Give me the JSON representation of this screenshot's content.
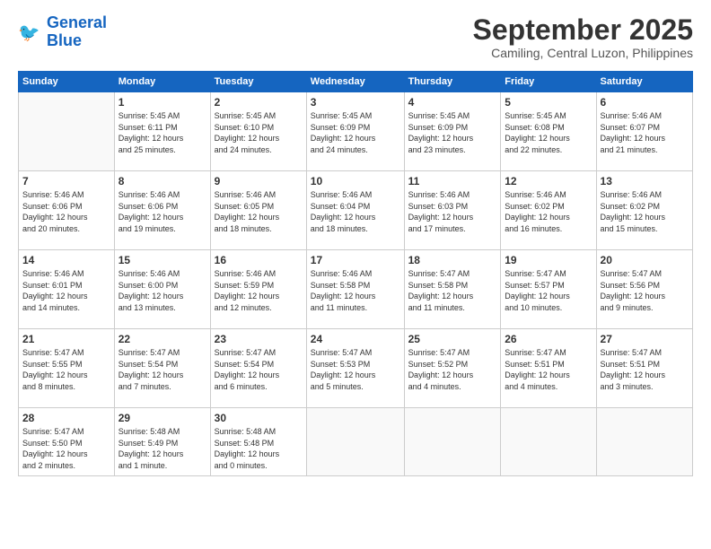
{
  "logo": {
    "line1": "General",
    "line2": "Blue"
  },
  "title": "September 2025",
  "location": "Camiling, Central Luzon, Philippines",
  "days_header": [
    "Sunday",
    "Monday",
    "Tuesday",
    "Wednesday",
    "Thursday",
    "Friday",
    "Saturday"
  ],
  "weeks": [
    [
      {
        "day": "",
        "info": ""
      },
      {
        "day": "1",
        "info": "Sunrise: 5:45 AM\nSunset: 6:11 PM\nDaylight: 12 hours\nand 25 minutes."
      },
      {
        "day": "2",
        "info": "Sunrise: 5:45 AM\nSunset: 6:10 PM\nDaylight: 12 hours\nand 24 minutes."
      },
      {
        "day": "3",
        "info": "Sunrise: 5:45 AM\nSunset: 6:09 PM\nDaylight: 12 hours\nand 24 minutes."
      },
      {
        "day": "4",
        "info": "Sunrise: 5:45 AM\nSunset: 6:09 PM\nDaylight: 12 hours\nand 23 minutes."
      },
      {
        "day": "5",
        "info": "Sunrise: 5:45 AM\nSunset: 6:08 PM\nDaylight: 12 hours\nand 22 minutes."
      },
      {
        "day": "6",
        "info": "Sunrise: 5:46 AM\nSunset: 6:07 PM\nDaylight: 12 hours\nand 21 minutes."
      }
    ],
    [
      {
        "day": "7",
        "info": "Sunrise: 5:46 AM\nSunset: 6:06 PM\nDaylight: 12 hours\nand 20 minutes."
      },
      {
        "day": "8",
        "info": "Sunrise: 5:46 AM\nSunset: 6:06 PM\nDaylight: 12 hours\nand 19 minutes."
      },
      {
        "day": "9",
        "info": "Sunrise: 5:46 AM\nSunset: 6:05 PM\nDaylight: 12 hours\nand 18 minutes."
      },
      {
        "day": "10",
        "info": "Sunrise: 5:46 AM\nSunset: 6:04 PM\nDaylight: 12 hours\nand 18 minutes."
      },
      {
        "day": "11",
        "info": "Sunrise: 5:46 AM\nSunset: 6:03 PM\nDaylight: 12 hours\nand 17 minutes."
      },
      {
        "day": "12",
        "info": "Sunrise: 5:46 AM\nSunset: 6:02 PM\nDaylight: 12 hours\nand 16 minutes."
      },
      {
        "day": "13",
        "info": "Sunrise: 5:46 AM\nSunset: 6:02 PM\nDaylight: 12 hours\nand 15 minutes."
      }
    ],
    [
      {
        "day": "14",
        "info": "Sunrise: 5:46 AM\nSunset: 6:01 PM\nDaylight: 12 hours\nand 14 minutes."
      },
      {
        "day": "15",
        "info": "Sunrise: 5:46 AM\nSunset: 6:00 PM\nDaylight: 12 hours\nand 13 minutes."
      },
      {
        "day": "16",
        "info": "Sunrise: 5:46 AM\nSunset: 5:59 PM\nDaylight: 12 hours\nand 12 minutes."
      },
      {
        "day": "17",
        "info": "Sunrise: 5:46 AM\nSunset: 5:58 PM\nDaylight: 12 hours\nand 11 minutes."
      },
      {
        "day": "18",
        "info": "Sunrise: 5:47 AM\nSunset: 5:58 PM\nDaylight: 12 hours\nand 11 minutes."
      },
      {
        "day": "19",
        "info": "Sunrise: 5:47 AM\nSunset: 5:57 PM\nDaylight: 12 hours\nand 10 minutes."
      },
      {
        "day": "20",
        "info": "Sunrise: 5:47 AM\nSunset: 5:56 PM\nDaylight: 12 hours\nand 9 minutes."
      }
    ],
    [
      {
        "day": "21",
        "info": "Sunrise: 5:47 AM\nSunset: 5:55 PM\nDaylight: 12 hours\nand 8 minutes."
      },
      {
        "day": "22",
        "info": "Sunrise: 5:47 AM\nSunset: 5:54 PM\nDaylight: 12 hours\nand 7 minutes."
      },
      {
        "day": "23",
        "info": "Sunrise: 5:47 AM\nSunset: 5:54 PM\nDaylight: 12 hours\nand 6 minutes."
      },
      {
        "day": "24",
        "info": "Sunrise: 5:47 AM\nSunset: 5:53 PM\nDaylight: 12 hours\nand 5 minutes."
      },
      {
        "day": "25",
        "info": "Sunrise: 5:47 AM\nSunset: 5:52 PM\nDaylight: 12 hours\nand 4 minutes."
      },
      {
        "day": "26",
        "info": "Sunrise: 5:47 AM\nSunset: 5:51 PM\nDaylight: 12 hours\nand 4 minutes."
      },
      {
        "day": "27",
        "info": "Sunrise: 5:47 AM\nSunset: 5:51 PM\nDaylight: 12 hours\nand 3 minutes."
      }
    ],
    [
      {
        "day": "28",
        "info": "Sunrise: 5:47 AM\nSunset: 5:50 PM\nDaylight: 12 hours\nand 2 minutes."
      },
      {
        "day": "29",
        "info": "Sunrise: 5:48 AM\nSunset: 5:49 PM\nDaylight: 12 hours\nand 1 minute."
      },
      {
        "day": "30",
        "info": "Sunrise: 5:48 AM\nSunset: 5:48 PM\nDaylight: 12 hours\nand 0 minutes."
      },
      {
        "day": "",
        "info": ""
      },
      {
        "day": "",
        "info": ""
      },
      {
        "day": "",
        "info": ""
      },
      {
        "day": "",
        "info": ""
      }
    ]
  ]
}
